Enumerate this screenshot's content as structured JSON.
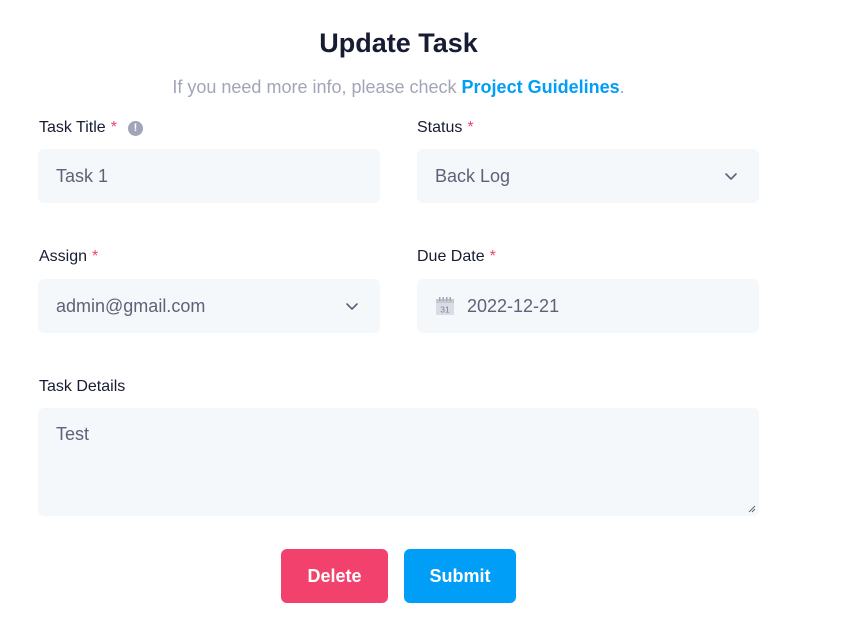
{
  "header": {
    "title": "Update Task",
    "subtitle_prefix": "If you need more info, please check ",
    "subtitle_link": "Project Guidelines",
    "subtitle_suffix": "."
  },
  "form": {
    "task_title": {
      "label": "Task Title",
      "required_mark": "*",
      "value": "Task 1",
      "info_icon": "info-icon"
    },
    "status": {
      "label": "Status",
      "required_mark": "*",
      "value": "Back Log",
      "icon": "chevron-down-icon"
    },
    "assign": {
      "label": "Assign",
      "required_mark": "*",
      "value": "admin@gmail.com",
      "icon": "chevron-down-icon"
    },
    "due_date": {
      "label": "Due Date",
      "required_mark": "*",
      "value": "2022-12-21",
      "icon": "calendar-icon",
      "icon_text": "31"
    },
    "task_details": {
      "label": "Task Details",
      "value": "Test"
    }
  },
  "actions": {
    "delete_label": "Delete",
    "submit_label": "Submit"
  },
  "colors": {
    "primary": "#009ef7",
    "danger": "#f1416c",
    "input_bg": "#f5f8fa",
    "muted": "#a1a5b7"
  }
}
